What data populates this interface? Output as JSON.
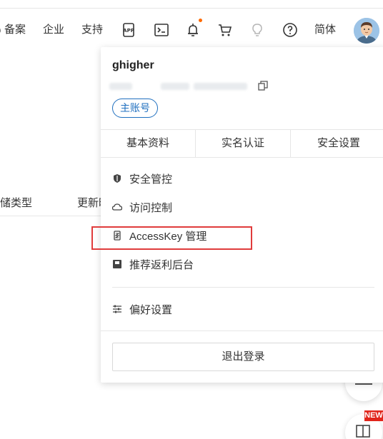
{
  "topbar": {
    "nav_filing": "备案",
    "nav_enterprise": "企业",
    "nav_support": "支持",
    "nav_language": "简体",
    "icons": [
      "app-icon",
      "terminal-icon",
      "bell-icon",
      "cart-icon",
      "lightbulb-icon",
      "help-icon"
    ]
  },
  "background": {
    "col_storage_type": "储类型",
    "col_updated": "更新时"
  },
  "account": {
    "username": "ghigher",
    "role_badge": "主账号"
  },
  "tabs": [
    "基本资料",
    "实名认证",
    "安全设置"
  ],
  "menu": {
    "security_control": "安全管控",
    "access_control": "访问控制",
    "accesskey": "AccessKey 管理",
    "affiliate": "推荐返利后台",
    "preferences": "偏好设置"
  },
  "logout": "退出登录",
  "badge_new": "NEW",
  "colors": {
    "accent": "#ff6a00",
    "badge_blue": "#1f6fbf",
    "highlight": "#e03c3c"
  }
}
